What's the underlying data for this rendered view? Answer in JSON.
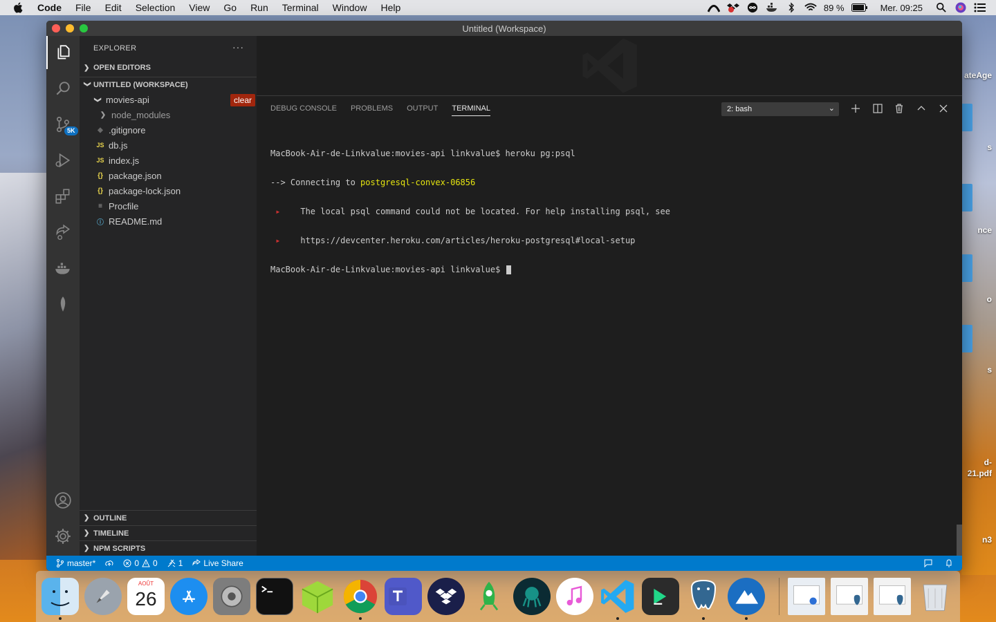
{
  "menubar": {
    "app_name": "Code",
    "items": [
      "File",
      "Edit",
      "Selection",
      "View",
      "Go",
      "Run",
      "Terminal",
      "Window",
      "Help"
    ],
    "battery": "89 %",
    "clock": "Mer. 09:25"
  },
  "desktop": {
    "labels": [
      "ateAge",
      "s",
      "nce",
      "o",
      "s",
      "d-",
      "21.pdf",
      "n3"
    ]
  },
  "window": {
    "title": "Untitled (Workspace)"
  },
  "activity": {
    "scm_badge": "5K"
  },
  "sidebar": {
    "header": "EXPLORER",
    "more": "···",
    "open_editors": "OPEN EDITORS",
    "workspace": "UNTITLED (WORKSPACE)",
    "folder": "movies-api",
    "clear_label": "clear",
    "files": [
      {
        "name": "node_modules",
        "icon": "chevron-right"
      },
      {
        "name": ".gitignore",
        "icon": "gitignore"
      },
      {
        "name": "db.js",
        "icon": "JS"
      },
      {
        "name": "index.js",
        "icon": "JS"
      },
      {
        "name": "package.json",
        "icon": "{}"
      },
      {
        "name": "package-lock.json",
        "icon": "{}"
      },
      {
        "name": "Procfile",
        "icon": "≡"
      },
      {
        "name": "README.md",
        "icon": "ⓘ"
      }
    ],
    "bottom_sections": [
      "OUTLINE",
      "TIMELINE",
      "NPM SCRIPTS"
    ]
  },
  "panel": {
    "tabs": [
      "DEBUG CONSOLE",
      "PROBLEMS",
      "OUTPUT",
      "TERMINAL"
    ],
    "active_tab": "TERMINAL",
    "terminal_select": "2: bash",
    "terminal": {
      "line1": "MacBook-Air-de-Linkvalue:movies-api linkvalue$ heroku pg:psql",
      "line2_prefix": "--> Connecting to ",
      "line2_db": "postgresql-convex-06856",
      "line3_bullet": " ▸",
      "line3_text": "    The local psql command could not be located. For help installing psql, see",
      "line4_bullet": " ▸",
      "line4_text": "    https://devcenter.heroku.com/articles/heroku-postgresql#local-setup",
      "line5": "MacBook-Air-de-Linkvalue:movies-api linkvalue$ "
    }
  },
  "statusbar": {
    "branch": "master*",
    "errors": "0",
    "warnings": "0",
    "ports": "1",
    "live_share": "Live Share"
  },
  "dock": {
    "calendar_month": "AOÛT",
    "calendar_day": "26"
  }
}
